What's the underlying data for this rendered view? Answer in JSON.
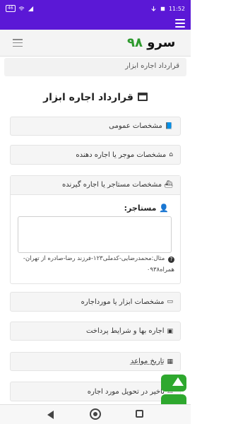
{
  "status_bar": {
    "time": "11:52",
    "battery": "46",
    "icons": [
      "battery-icon",
      "wifi-icon",
      "signal-icon",
      "download-icon",
      "notification-icon"
    ]
  },
  "header": {
    "logo_word": "سرو",
    "logo_num": "۹۸",
    "logo_color": "#2e9a2e",
    "menu_icon": "hamburger-icon",
    "bar_color": "#5b18d6"
  },
  "breadcrumb": "قرارداد اجاره ابزار",
  "page_title": "قرارداد اجاره ابزار",
  "sections": {
    "general": {
      "label": "مشخصات عمومی",
      "icon": "book-icon"
    },
    "lessor": {
      "label": "مشخصات موجر یا اجاره دهنده",
      "icon": "home-icon"
    },
    "lessee": {
      "label": "مشخصات مستاجر یا اجاره گیرنده",
      "icon": "ship-icon"
    },
    "tools": {
      "label": "مشخصات ابزار یا مورداجاره",
      "icon": "card-icon"
    },
    "price": {
      "label": "اجاره بها و شرایط پرداخت",
      "icon": "money-icon"
    },
    "dates": {
      "label": "تاریخ مواعد",
      "icon": "calendar-icon"
    },
    "delay": {
      "label": "تاخیر در تحویل مورد اجاره",
      "icon": "alert-icon"
    }
  },
  "tenant": {
    "label": "مستاجر:",
    "icon": "user-icon",
    "value": "",
    "hint": "مثال:محمدرضایی-کدملی۱۲۳-فرزند رضا-صادره از تهران-همراه۰۹۳۸"
  }
}
